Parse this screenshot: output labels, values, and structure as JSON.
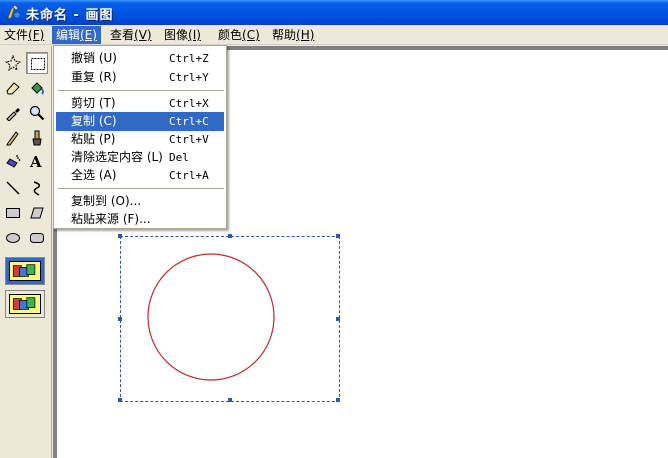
{
  "window": {
    "title": "未命名 - 画图"
  },
  "menubar": {
    "items": [
      {
        "label": "文件",
        "accel": "(F)"
      },
      {
        "label": "编辑",
        "accel": "(E)"
      },
      {
        "label": "查看",
        "accel": "(V)"
      },
      {
        "label": "图像",
        "accel": "(I)"
      },
      {
        "label": "颜色",
        "accel": "(C)"
      },
      {
        "label": "帮助",
        "accel": "(H)"
      }
    ],
    "active_index": 1
  },
  "edit_menu": {
    "items": [
      {
        "label": "撤销 (U)",
        "shortcut": "Ctrl+Z"
      },
      {
        "label": "重复 (R)",
        "shortcut": "Ctrl+Y"
      },
      {
        "label": "剪切 (T)",
        "shortcut": "Ctrl+X"
      },
      {
        "label": "复制 (C)",
        "shortcut": "Ctrl+C",
        "highlighted": true
      },
      {
        "label": "粘贴 (P)",
        "shortcut": "Ctrl+V"
      },
      {
        "label": "清除选定内容 (L)",
        "shortcut": "Del"
      },
      {
        "label": "全选 (A)",
        "shortcut": "Ctrl+A"
      },
      {
        "label": "复制到 (O)...",
        "shortcut": ""
      },
      {
        "label": "粘贴来源 (F)...",
        "shortcut": ""
      }
    ]
  },
  "toolbox": {
    "tools": [
      "free-select-icon",
      "rect-select-icon",
      "eraser-icon",
      "fill-bucket-icon",
      "color-picker-icon",
      "magnifier-icon",
      "pencil-icon",
      "brush-icon",
      "airbrush-icon",
      "text-tool-icon",
      "line-icon",
      "curve-icon",
      "rectangle-icon",
      "polygon-icon",
      "ellipse-icon",
      "rounded-rect-icon"
    ],
    "selected_tool": "rect-select-icon",
    "text_tool_glyph": "A"
  },
  "canvas": {
    "circle_color": "#c0282a",
    "selection_color": "#2a5bb0"
  }
}
